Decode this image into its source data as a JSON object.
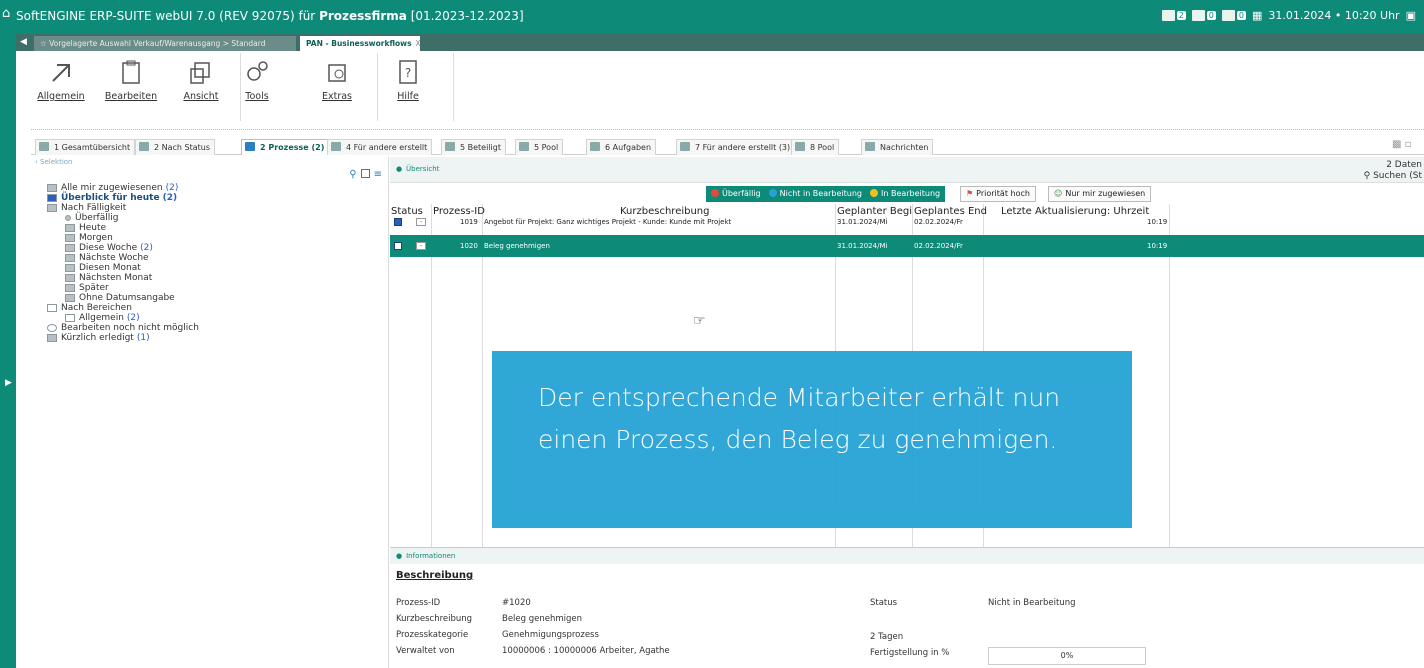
{
  "titlebar": {
    "app_name": "SoftENGINE ERP-SUITE webUI 7.0 (REV 92075) für",
    "company": "Prozessfirma",
    "period": "[01.2023-12.2023]",
    "badges": [
      "2",
      "0",
      "0"
    ],
    "datetime": "31.01.2024 • 10:20 Uhr"
  },
  "doc_tabs": {
    "inactive": "Vorgelagerte Auswahl Verkauf/Warenausgang > Standard",
    "active": "PAN - Businessworkflows",
    "close": "X"
  },
  "ribbon": {
    "buttons": [
      "Allgemein",
      "Bearbeiten",
      "Ansicht",
      "Tools",
      "Extras",
      "Hilfe"
    ]
  },
  "view_tabs": [
    "1 Gesamtübersicht",
    "2 Nach Status",
    "2 Prozesse (2)",
    "4 Für andere erstellt",
    "5 Beteiligt",
    "5 Pool",
    "6 Aufgaben",
    "7 Für andere erstellt (3)",
    "8 Pool",
    "Nachrichten"
  ],
  "left_panel": {
    "header": "Selektion",
    "tree": [
      {
        "label": "Alle mir zugewiesenen",
        "count": "(2)"
      },
      {
        "label": "Überblick für heute",
        "count": "(2)"
      },
      {
        "label": "Nach Fälligkeit",
        "count": ""
      },
      {
        "label": "Überfällig",
        "count": ""
      },
      {
        "label": "Heute",
        "count": ""
      },
      {
        "label": "Morgen",
        "count": ""
      },
      {
        "label": "Diese Woche",
        "count": "(2)"
      },
      {
        "label": "Nächste Woche",
        "count": ""
      },
      {
        "label": "Diesen Monat",
        "count": ""
      },
      {
        "label": "Nächsten Monat",
        "count": ""
      },
      {
        "label": "Später",
        "count": ""
      },
      {
        "label": "Ohne Datumsangabe",
        "count": ""
      },
      {
        "label": "Nach Bereichen",
        "count": ""
      },
      {
        "label": "Allgemein",
        "count": "(2)"
      },
      {
        "label": "Bearbeiten noch nicht möglich",
        "count": ""
      },
      {
        "label": "Kürzlich erledigt",
        "count": "(1)"
      }
    ]
  },
  "right_panel": {
    "caption": "Übersicht",
    "count": "2 Daten",
    "search": "Suchen (St",
    "filters": [
      "Überfällig",
      "Nicht in Bearbeitung",
      "In Bearbeitung"
    ],
    "filter_colors": [
      "#e04a3f",
      "#2a9fd6",
      "#f0c020"
    ],
    "buttons": [
      "Priorität hoch",
      "Nur mir zugewiesen"
    ],
    "columns": [
      "Status",
      "Prozess-ID",
      "Kurzbeschreibung",
      "Geplanter Begin",
      "Geplantes End",
      "Letzte Aktualisierung: Uhrzeit"
    ],
    "rows": [
      {
        "id": "1019",
        "desc": "Angebot für Projekt: Ganz wichtiges Projekt - Kunde: Kunde mit Projekt",
        "begin": "31.01.2024/Mi",
        "end": "02.02.2024/Fr",
        "time": "10:19"
      },
      {
        "id": "1020",
        "desc": "Beleg genehmigen",
        "begin": "31.01.2024/Mi",
        "end": "02.02.2024/Fr",
        "time": "10:19"
      }
    ]
  },
  "overlay": {
    "text": "Der entsprechende Mitarbeiter erhält nun einen Prozess, den Beleg zu genehmigen."
  },
  "info": {
    "caption": "Informationen",
    "title": "Beschreibung",
    "labels": [
      "Prozess-ID",
      "Kurzbeschreibung",
      "Prozesskategorie",
      "Verwaltet von"
    ],
    "values": [
      "#1020",
      "Beleg genehmigen",
      "Genehmigungsprozess",
      "10000006 : 10000006 Arbeiter, Agathe"
    ],
    "status_label": "Status",
    "status_value": "Nicht in Bearbeitung",
    "duration": "2 Tagen",
    "progress_label": "Fertigstellung in %",
    "progress_value": "0%"
  }
}
